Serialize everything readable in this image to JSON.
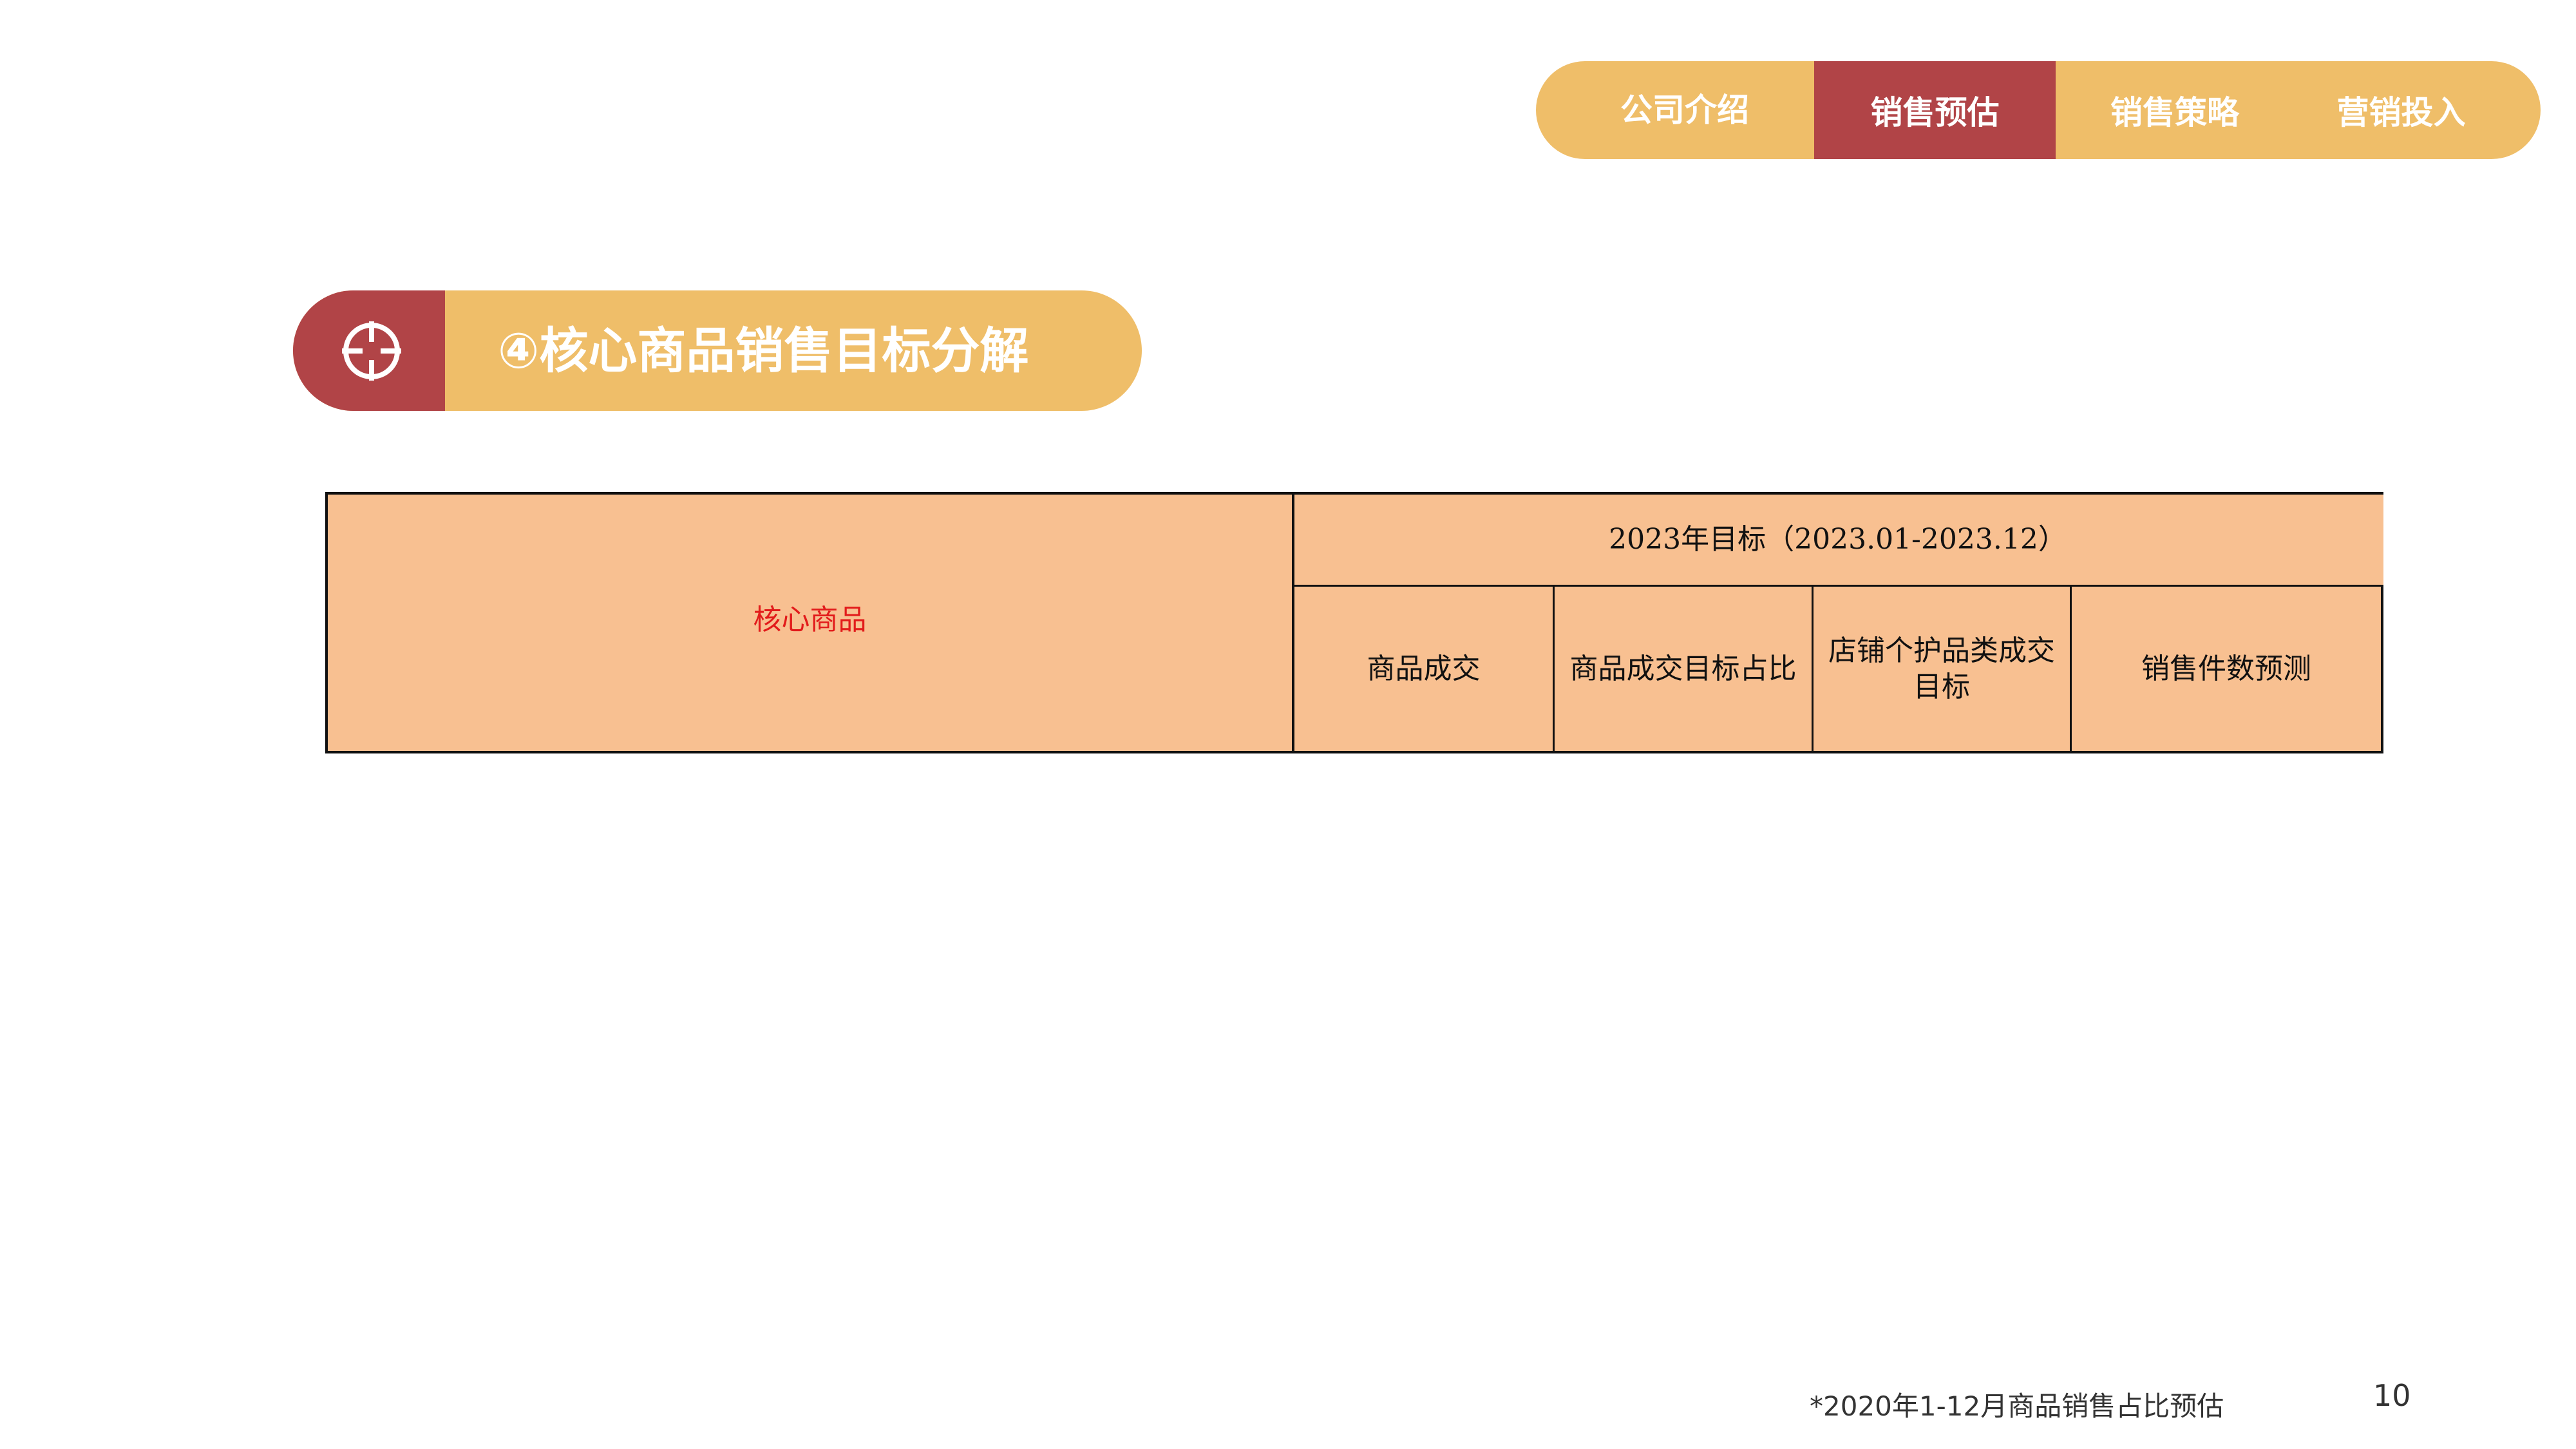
{
  "nav": {
    "items": [
      "公司介绍",
      "销售预估",
      "销售策略",
      "营销投入"
    ],
    "active_index": 1,
    "color_bg": "#EFBE69",
    "color_active": "#B14447"
  },
  "section": {
    "title": "④核心商品销售目标分解",
    "icon": "crosshair-icon"
  },
  "table": {
    "row_header": "核心商品",
    "group_header": "2023年目标（2023.01-2023.12）",
    "columns": [
      "商品成交",
      "商品成交目标占比",
      "店铺个护品类成交\n目标",
      "销售件数预测"
    ],
    "fill_color": "#F8C091"
  },
  "footer": {
    "note": "*2020年1-12月商品销售占比预估",
    "page_number": "10"
  }
}
